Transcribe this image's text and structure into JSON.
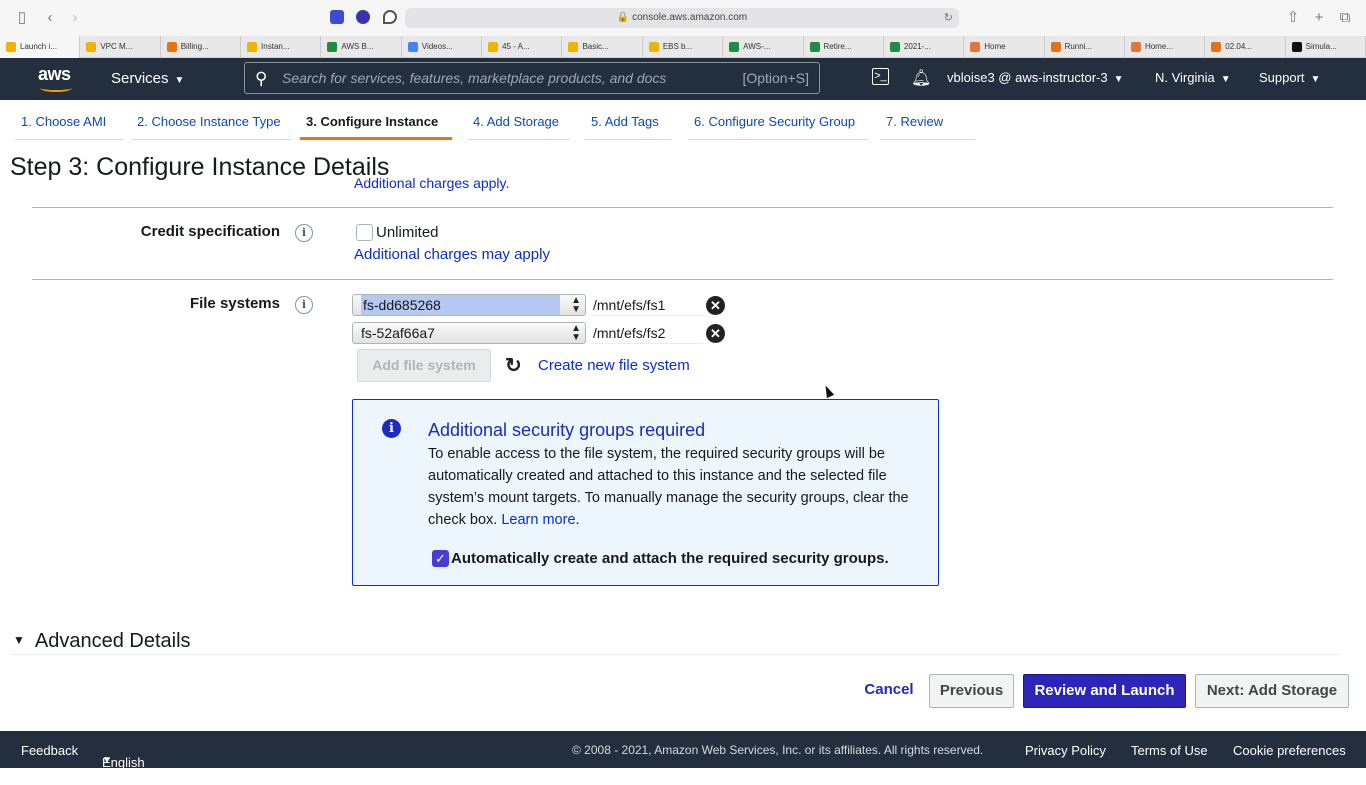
{
  "browser": {
    "url": "console.aws.amazon.com",
    "tabs": [
      "Launch i...",
      "VPC M...",
      "Billing...",
      "Instan...",
      "AWS B...",
      "Videos...",
      "45 - A...",
      "Basic...",
      "EBS b...",
      "AWS-...",
      "Retire...",
      "2021-...",
      "Home",
      "Runni...",
      "Home...",
      "02.04...",
      "Simula..."
    ]
  },
  "header": {
    "logo": "aws",
    "services_label": "Services",
    "search_placeholder": "Search for services, features, marketplace products, and docs",
    "search_shortcut": "[Option+S]",
    "account": "vbloise3 @ aws-instructor-3",
    "region": "N. Virginia",
    "support": "Support"
  },
  "wizard": {
    "tabs": [
      "1. Choose AMI",
      "2. Choose Instance Type",
      "3. Configure Instance",
      "4. Add Storage",
      "5. Add Tags",
      "6. Configure Security Group",
      "7. Review"
    ],
    "active_index": 2
  },
  "page": {
    "title": "Step 3: Configure Instance Details",
    "charges_link": "Additional charges apply.",
    "credit": {
      "label": "Credit specification",
      "checkbox_label": "Unlimited",
      "checked": false,
      "link": "Additional charges may apply"
    },
    "file_systems": {
      "label": "File systems",
      "rows": [
        {
          "fs": "fs-dd685268",
          "mount": "/mnt/efs/fs1"
        },
        {
          "fs": "fs-52af66a7",
          "mount": "/mnt/efs/fs2"
        }
      ],
      "add_button": "Add file system",
      "create_link": "Create new file system"
    },
    "alert": {
      "title": "Additional security groups required",
      "body": "To enable access to the file system, the required security groups will be automatically created and attached to this instance and the selected file system’s mount targets. To manually manage the security groups, clear the check box.",
      "learn_more": "Learn more",
      "checkbox_label": "Automatically create and attach the required security groups.",
      "checked": true
    },
    "advanced": "Advanced Details"
  },
  "actions": {
    "cancel": "Cancel",
    "previous": "Previous",
    "review_launch": "Review and Launch",
    "next": "Next: Add Storage"
  },
  "footer": {
    "feedback": "Feedback",
    "language": "English (US)",
    "copyright": "© 2008 - 2021, Amazon Web Services, Inc. or its affiliates. All rights reserved.",
    "privacy": "Privacy Policy",
    "terms": "Terms of Use",
    "cookies": "Cookie preferences"
  },
  "colors": {
    "header_bg": "#232f3e",
    "accent_orange": "#ec7211",
    "primary_button": "#2d25b8",
    "link": "#0a2ecf"
  }
}
